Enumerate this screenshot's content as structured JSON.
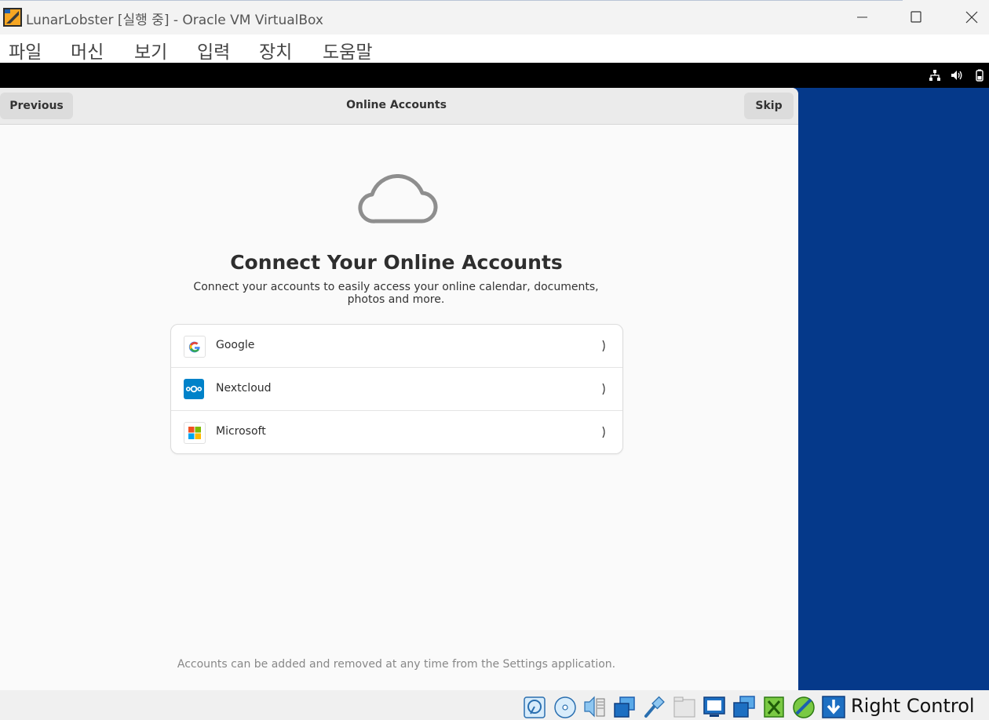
{
  "window": {
    "title": "LunarLobster [실행 중] - Oracle VM VirtualBox",
    "controls": [
      "minimize-icon",
      "maximize-icon",
      "close-icon"
    ]
  },
  "menu": {
    "items": [
      "파일",
      "머신",
      "보기",
      "입력",
      "장치",
      "도움말"
    ]
  },
  "guest_tray": {
    "icons": [
      "network-icon",
      "volume-icon",
      "battery-icon"
    ]
  },
  "dialog": {
    "header": {
      "previous_label": "Previous",
      "title": "Online Accounts",
      "skip_label": "Skip"
    },
    "hero_icon": "cloud-icon",
    "heading": "Connect Your Online Accounts",
    "subtitle": "Connect your accounts to easily access your online calendar, documents, photos and more.",
    "accounts": [
      {
        "label": "Google",
        "icon": "google-icon"
      },
      {
        "label": "Nextcloud",
        "icon": "nextcloud-icon"
      },
      {
        "label": "Microsoft",
        "icon": "microsoft-icon"
      }
    ],
    "footer": "Accounts can be added and removed at any time from the Settings application."
  },
  "statusbar": {
    "icons": [
      "hard-disk-icon",
      "optical-disk-icon",
      "audio-icon",
      "network-icon",
      "usb-icon",
      "shared-folders-icon",
      "display-icon",
      "recording-icon",
      "mouse-integration-icon",
      "guest-additions-icon",
      "host-key-arrow-icon"
    ],
    "host_key": "Right Control"
  },
  "colors": {
    "guest_background": "#05398a",
    "dialog_background": "#fafafa",
    "header_button": "#dcdcdc",
    "nextcloud_blue": "#0082c9"
  }
}
